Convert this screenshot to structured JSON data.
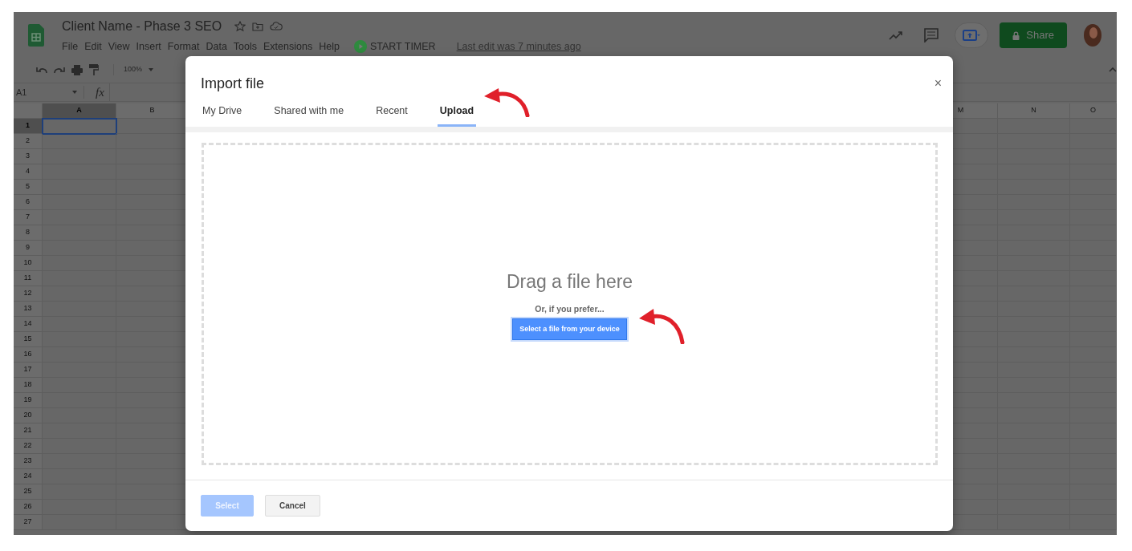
{
  "app": {
    "title": "Client Name - Phase 3 SEO",
    "menu": [
      "File",
      "Edit",
      "View",
      "Insert",
      "Format",
      "Data",
      "Tools",
      "Extensions",
      "Help"
    ],
    "timer_button": "START TIMER",
    "last_edit": "Last edit was 7 minutes ago",
    "share_button": "Share"
  },
  "toolbar": {
    "zoom": "100%"
  },
  "formula_bar": {
    "cell_ref": "A1",
    "fx": "fx"
  },
  "grid": {
    "columns": [
      {
        "label": "A",
        "selected": true
      },
      {
        "label": "B",
        "selected": false
      },
      {
        "label": "M",
        "selected": false
      },
      {
        "label": "N",
        "selected": false
      },
      {
        "label": "O",
        "selected": false
      }
    ],
    "rows": [
      {
        "label": "1",
        "selected": true
      },
      {
        "label": "2",
        "selected": false
      },
      {
        "label": "3",
        "selected": false
      },
      {
        "label": "4",
        "selected": false
      },
      {
        "label": "5",
        "selected": false
      },
      {
        "label": "6",
        "selected": false
      },
      {
        "label": "7",
        "selected": false
      },
      {
        "label": "8",
        "selected": false
      },
      {
        "label": "9",
        "selected": false
      },
      {
        "label": "10",
        "selected": false
      },
      {
        "label": "11",
        "selected": false
      },
      {
        "label": "12",
        "selected": false
      },
      {
        "label": "13",
        "selected": false
      },
      {
        "label": "14",
        "selected": false
      },
      {
        "label": "15",
        "selected": false
      },
      {
        "label": "16",
        "selected": false
      },
      {
        "label": "17",
        "selected": false
      },
      {
        "label": "18",
        "selected": false
      },
      {
        "label": "19",
        "selected": false
      },
      {
        "label": "20",
        "selected": false
      },
      {
        "label": "21",
        "selected": false
      },
      {
        "label": "22",
        "selected": false
      },
      {
        "label": "23",
        "selected": false
      },
      {
        "label": "24",
        "selected": false
      },
      {
        "label": "25",
        "selected": false
      },
      {
        "label": "26",
        "selected": false
      },
      {
        "label": "27",
        "selected": false
      }
    ]
  },
  "dialog": {
    "title": "Import file",
    "close": "×",
    "tabs": [
      {
        "label": "My Drive",
        "selected": false
      },
      {
        "label": "Shared with me",
        "selected": false
      },
      {
        "label": "Recent",
        "selected": false
      },
      {
        "label": "Upload",
        "selected": true
      }
    ],
    "drop_heading": "Drag a file here",
    "drop_hint": "Or, if you prefer...",
    "select_file_button": "Select a file from your device",
    "footer_buttons": [
      {
        "label": "Select",
        "kind": "primary",
        "disabled": true
      },
      {
        "label": "Cancel",
        "kind": "secondary",
        "disabled": false
      }
    ]
  }
}
